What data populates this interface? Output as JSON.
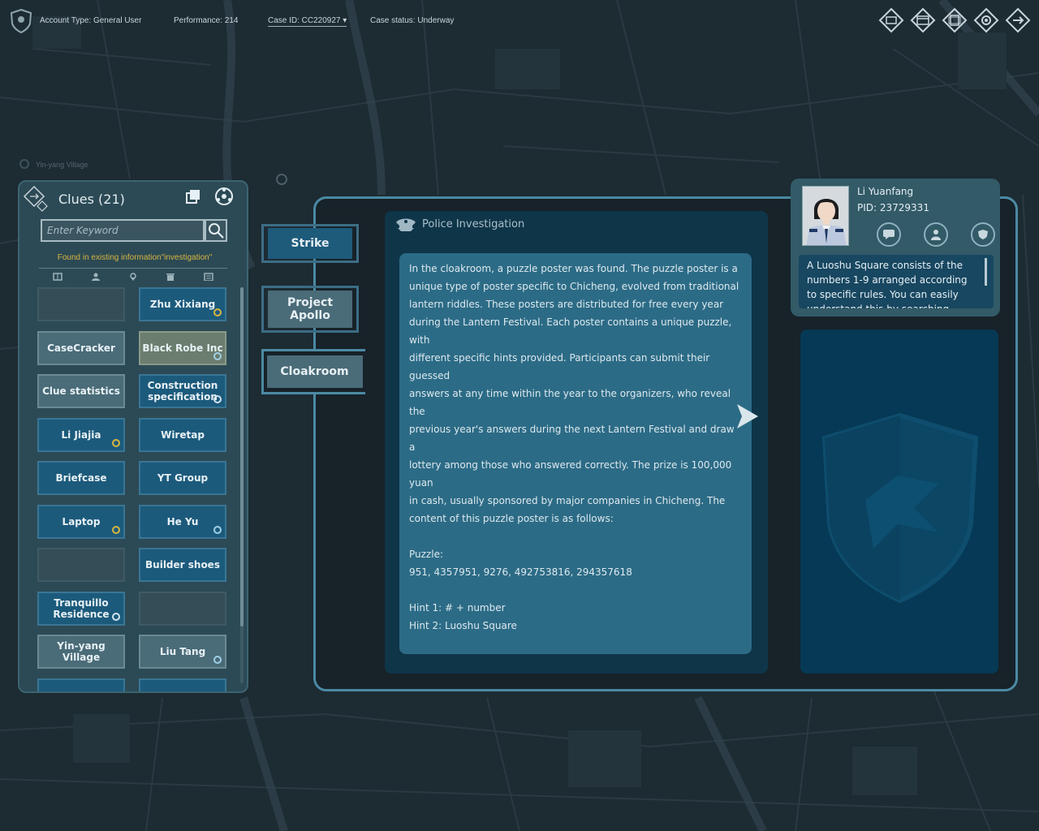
{
  "topbar": {
    "account_type": "Account Type: General User",
    "performance": "Performance: 214",
    "case_id": "Case ID: CC220927 ▾",
    "case_status": "Case status: Underway",
    "icons": [
      "inbox-icon",
      "wallet-icon",
      "cards-icon",
      "gear-icon",
      "exit-icon"
    ]
  },
  "map": {
    "location_label": "Yin-yang Village"
  },
  "clues": {
    "title": "Clues  (21)",
    "search_placeholder": "Enter Keyword",
    "found_text": "Found in existing information\"investigation\"",
    "filters": [
      "document-icon",
      "person-icon",
      "location-icon",
      "trash-icon",
      "archive-icon"
    ],
    "items": [
      {
        "label": "",
        "style": "empty"
      },
      {
        "label": "Zhu Xixiang",
        "style": "blue",
        "badge": "star"
      },
      {
        "label": "CaseCracker",
        "style": "gray"
      },
      {
        "label": "Black Robe Inc",
        "style": "olive",
        "badge": "share"
      },
      {
        "label": "Clue statistics",
        "style": "gray"
      },
      {
        "label": "Construction specification",
        "style": "blue",
        "badge": "image"
      },
      {
        "label": "Li Jiajia",
        "style": "blue",
        "badge": "star"
      },
      {
        "label": "Wiretap",
        "style": "blue"
      },
      {
        "label": "Briefcase",
        "style": "blue"
      },
      {
        "label": "YT Group",
        "style": "blue"
      },
      {
        "label": "Laptop",
        "style": "blue",
        "badge": "shield"
      },
      {
        "label": "He Yu",
        "style": "blue",
        "badge": "target"
      },
      {
        "label": "",
        "style": "empty"
      },
      {
        "label": "Builder shoes",
        "style": "blue"
      },
      {
        "label": "Tranquillo Residence",
        "style": "blue",
        "badge": "tool"
      },
      {
        "label": "",
        "style": "empty"
      },
      {
        "label": "Yin-yang Village",
        "style": "gray"
      },
      {
        "label": "Liu Tang",
        "style": "gray",
        "badge": "target"
      },
      {
        "label": "",
        "style": "blue"
      },
      {
        "label": "",
        "style": "blue"
      }
    ]
  },
  "tabs": [
    {
      "label": "Strike",
      "state": "normal"
    },
    {
      "label": "Project Apollo",
      "state": "normal"
    },
    {
      "label": "Cloakroom",
      "state": "active"
    }
  ],
  "content": {
    "header": "Police Investigation",
    "body": "In the cloakroom, a puzzle poster was found. The puzzle poster is a\nunique type of poster specific to Chicheng, evolved from traditional\nlantern riddles. These posters are distributed for free every year\nduring the Lantern Festival. Each poster contains a unique puzzle, with\ndifferent specific hints provided. Participants can submit their guessed\nanswers at any time within the year to the organizers, who reveal the\nprevious year's answers during the next Lantern Festival and draw a\nlottery among those who answered correctly. The prize is 100,000 yuan\nin cash, usually sponsored by major companies in Chicheng. The\ncontent of this puzzle poster is as follows:\n\nPuzzle:\n951, 4357951, 9276, 492753816, 294357618\n\nHint 1: # + number\nHint 2: Luoshu Square"
  },
  "character": {
    "name": "Li Yuanfang",
    "pid": "PID:  23729331",
    "actions": [
      "chat-icon",
      "profile-icon",
      "badge-icon"
    ],
    "description": "A Luoshu Square consists of the numbers 1-9 arranged according to specific rules. You can easily understand this by searching online."
  },
  "colors": {
    "accent": "#4b8aa3",
    "tile_blue": "#1c5a7c",
    "tile_gray": "#4a6b78",
    "highlight": "#d8b540",
    "background": "#1c2a32"
  }
}
